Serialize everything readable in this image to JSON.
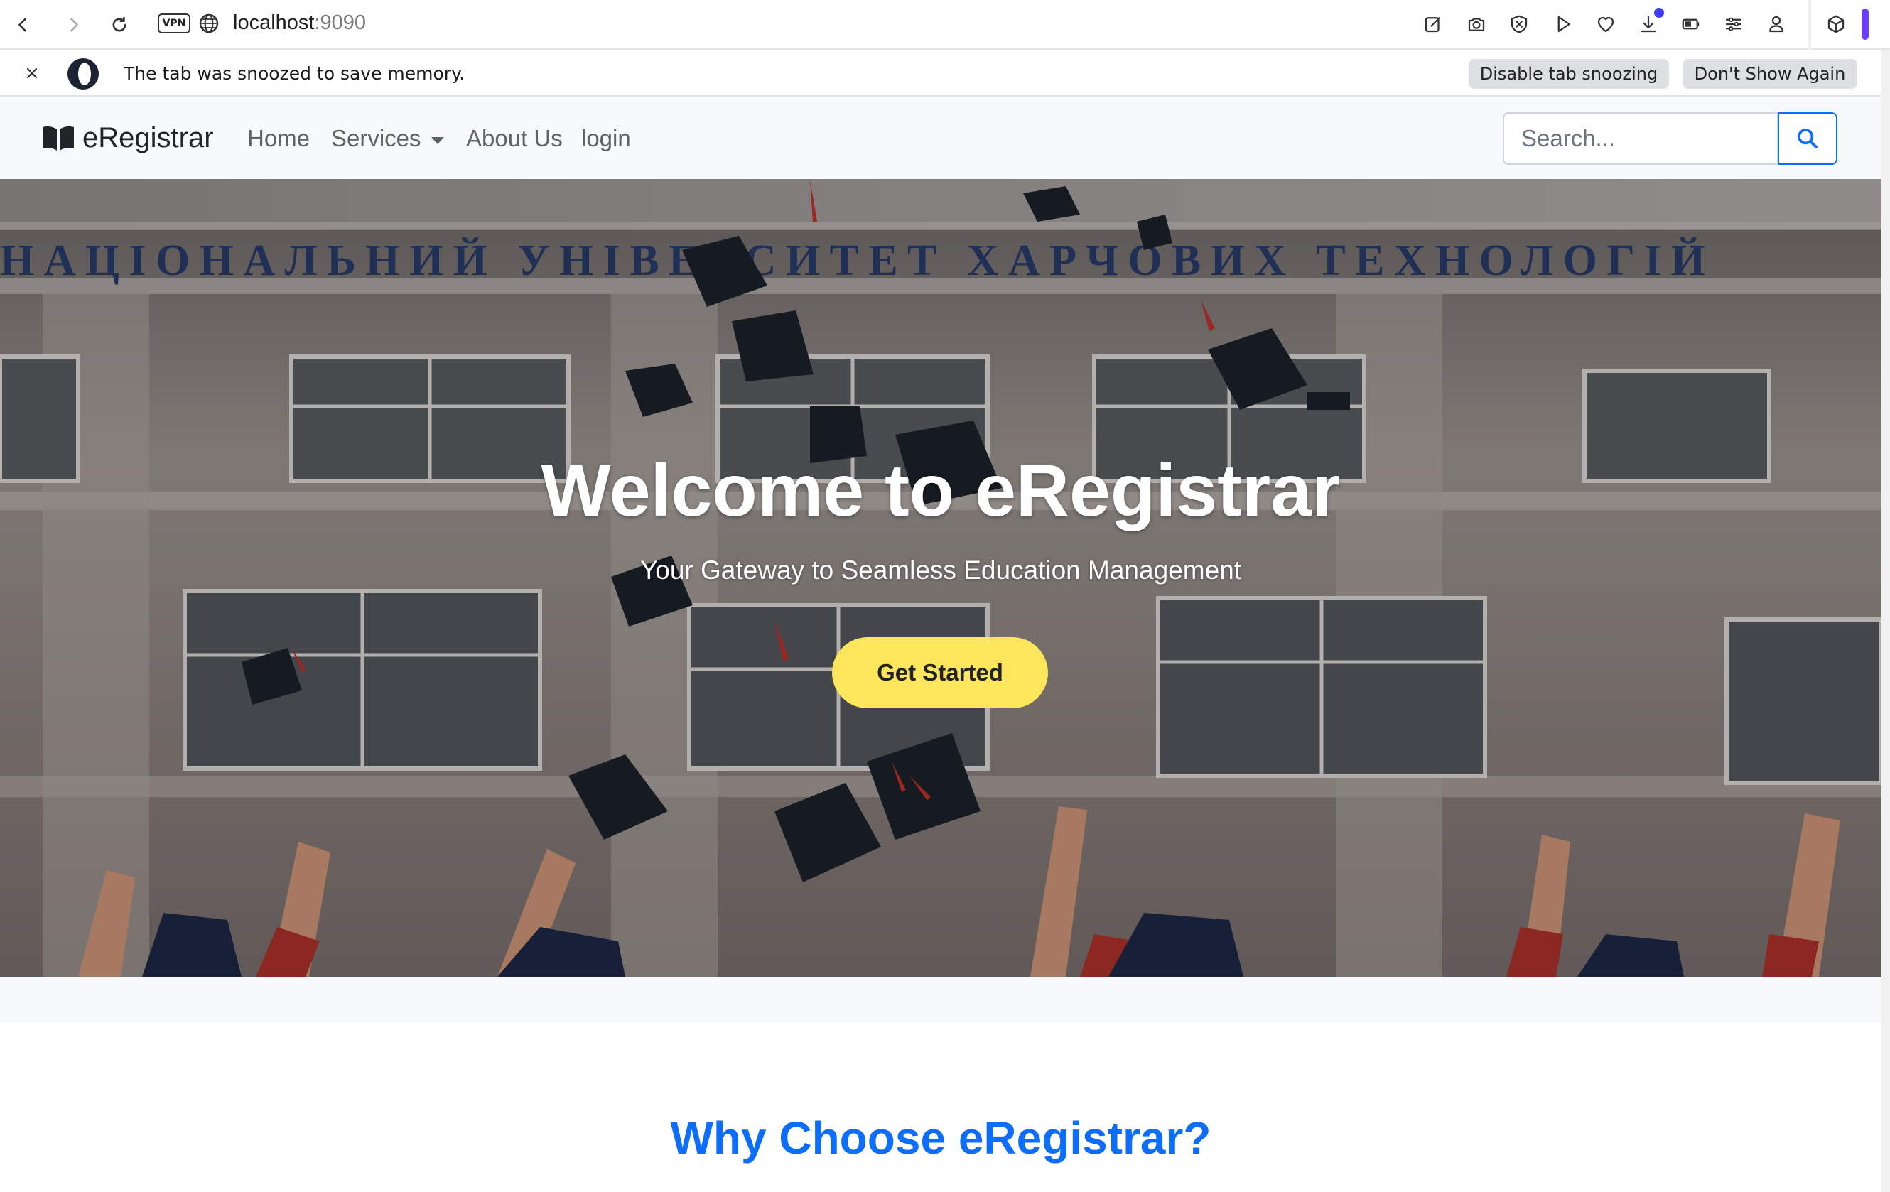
{
  "browser": {
    "vpn_label": "VPN",
    "url_host": "localhost",
    "url_port": ":9090"
  },
  "snooze_bar": {
    "message": "The tab was snoozed to save memory.",
    "disable_label": "Disable tab snoozing",
    "dont_show_label": "Don't Show Again"
  },
  "navbar": {
    "brand": "eRegistrar",
    "links": [
      "Home",
      "Services",
      "About Us",
      "login"
    ],
    "search_placeholder": "Search..."
  },
  "hero": {
    "title": "Welcome to eRegistrar",
    "subtitle": "Your Gateway to Seamless Education Management",
    "cta_label": "Get Started",
    "building_sign": "НАЦІОНАЛЬНИЙ УНІВЕРСИТЕТ ХАРЧОВИХ ТЕХНОЛОГІЙ"
  },
  "section": {
    "why_title": "Why Choose eRegistrar?"
  },
  "colors": {
    "primary": "#0d6efd",
    "cta": "#fde65c",
    "nav_bg": "#f8f9fa"
  }
}
